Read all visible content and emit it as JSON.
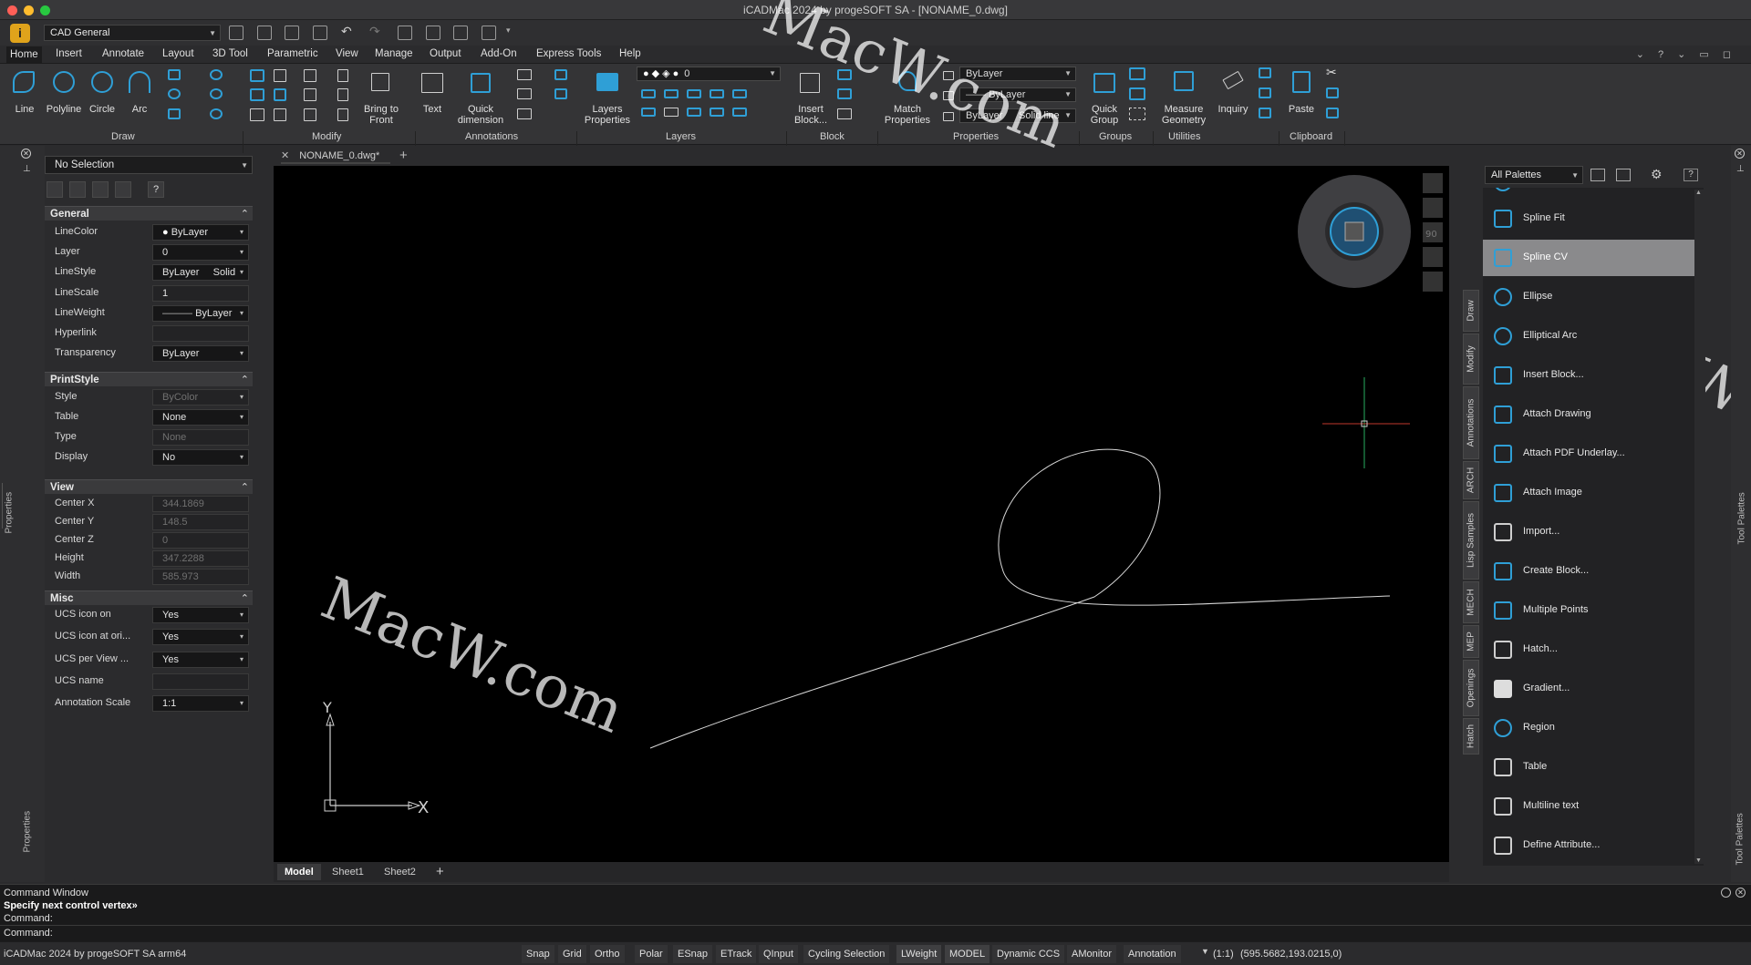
{
  "window": {
    "title": "iCADMac 2024 by progeSOFT SA - [NONAME_0.dwg]"
  },
  "toolbar": {
    "workspace": "CAD General"
  },
  "menu": {
    "items": [
      "Home",
      "Insert",
      "Annotate",
      "Layout",
      "3D Tool",
      "Parametric",
      "View",
      "Manage",
      "Output",
      "Add-On",
      "Express Tools",
      "Help"
    ],
    "right_controls": "⌄ ? ⌄ ▭ ◻"
  },
  "ribbon": {
    "groups": {
      "draw": "Draw",
      "modify": "Modify",
      "annotations": "Annotations",
      "layers": "Layers",
      "block": "Block",
      "properties": "Properties",
      "groups": "Groups",
      "utilities": "Utilities",
      "clipboard": "Clipboard"
    },
    "buttons": {
      "line": "Line",
      "polyline": "Polyline",
      "circle": "Circle",
      "arc": "Arc",
      "bring_to_front": "Bring to\nFront",
      "text": "Text",
      "quick_dimension": "Quick\ndimension",
      "layers_properties": "Layers\nProperties",
      "insert_block": "Insert\nBlock...",
      "match_properties": "Match\nProperties",
      "quick_group": "Quick\nGroup",
      "measure_geometry": "Measure\nGeometry",
      "inquiry": "Inquiry",
      "paste": "Paste"
    },
    "layer_value": "0",
    "prop_color": "ByLayer",
    "prop_lineweight": "ByLayer",
    "prop_linestyle_by": "ByLayer",
    "prop_linestyle": "Solid line"
  },
  "properties": {
    "selection": "No Selection",
    "sections": {
      "general": "General",
      "printstyle": "PrintStyle",
      "view": "View",
      "misc": "Misc"
    },
    "general": [
      {
        "name": "LineColor",
        "value": "ByLayer"
      },
      {
        "name": "Layer",
        "value": "0"
      },
      {
        "name": "LineStyle",
        "value": "ByLayer     Solid"
      },
      {
        "name": "LineScale",
        "value": "1"
      },
      {
        "name": "LineWeight",
        "value": "ByLayer"
      },
      {
        "name": "Hyperlink",
        "value": ""
      },
      {
        "name": "Transparency",
        "value": "ByLayer"
      }
    ],
    "printstyle": [
      {
        "name": "Style",
        "value": "ByColor"
      },
      {
        "name": "Table",
        "value": "None"
      },
      {
        "name": "Type",
        "value": "None"
      },
      {
        "name": "Display",
        "value": "No"
      }
    ],
    "view": [
      {
        "name": "Center X",
        "value": "344.1869"
      },
      {
        "name": "Center Y",
        "value": "148.5"
      },
      {
        "name": "Center Z",
        "value": "0"
      },
      {
        "name": "Height",
        "value": "347.2288"
      },
      {
        "name": "Width",
        "value": "585.973"
      }
    ],
    "misc": [
      {
        "name": "UCS icon on",
        "value": "Yes"
      },
      {
        "name": "UCS icon at ori...",
        "value": "Yes"
      },
      {
        "name": "UCS per View ...",
        "value": "Yes"
      },
      {
        "name": "UCS name",
        "value": ""
      },
      {
        "name": "Annotation Scale",
        "value": "1:1"
      }
    ],
    "help": "?"
  },
  "side_labels": {
    "properties": "Properties",
    "tool_palettes": "Tool Palettes"
  },
  "document": {
    "tab": "NONAME_0.dwg*"
  },
  "layouts": {
    "tabs": [
      "Model",
      "Sheet1",
      "Sheet2"
    ],
    "add": "+"
  },
  "ucs": {
    "x": "X",
    "y": "Y"
  },
  "viewcube": {
    "label": "90"
  },
  "watermarks": [
    "MacW.com",
    "MacW.com",
    "MacW.com"
  ],
  "palette": {
    "selector": "All Palettes",
    "tabs": [
      "Draw",
      "Modify",
      "Annotations",
      "ARCH",
      "Lisp Samples",
      "MECH",
      "MEP",
      "Openings",
      "Hatch"
    ],
    "items": [
      "Spline Fit",
      "Spline CV",
      "Ellipse",
      "Elliptical Arc",
      "Insert Block...",
      "Attach Drawing",
      "Attach PDF Underlay...",
      "Attach Image",
      "Import...",
      "Create Block...",
      "Multiple Points",
      "Hatch...",
      "Gradient...",
      "Region",
      "Table",
      "Multiline text",
      "Define Attribute..."
    ],
    "selected": "Spline CV"
  },
  "command": {
    "title": "Command Window",
    "prompt": "Specify next control vertex»",
    "line1": "Command:",
    "line2": "Command:"
  },
  "status": {
    "app": "iCADMac 2024 by progeSOFT SA arm64",
    "buttons": [
      "Snap",
      "Grid",
      "Ortho",
      "Polar",
      "ESnap",
      "ETrack",
      "QInput",
      "Cycling Selection",
      "LWeight",
      "MODEL",
      "Dynamic CCS",
      "AMonitor",
      "Annotation"
    ],
    "scale": "(1:1)",
    "coords": "(595.5682,193.0215,0)"
  },
  "colors": {
    "accent": "#2f9fd6",
    "canvas": "#000000",
    "crosshair_x": "#c0392b",
    "crosshair_y": "#27ae60"
  }
}
